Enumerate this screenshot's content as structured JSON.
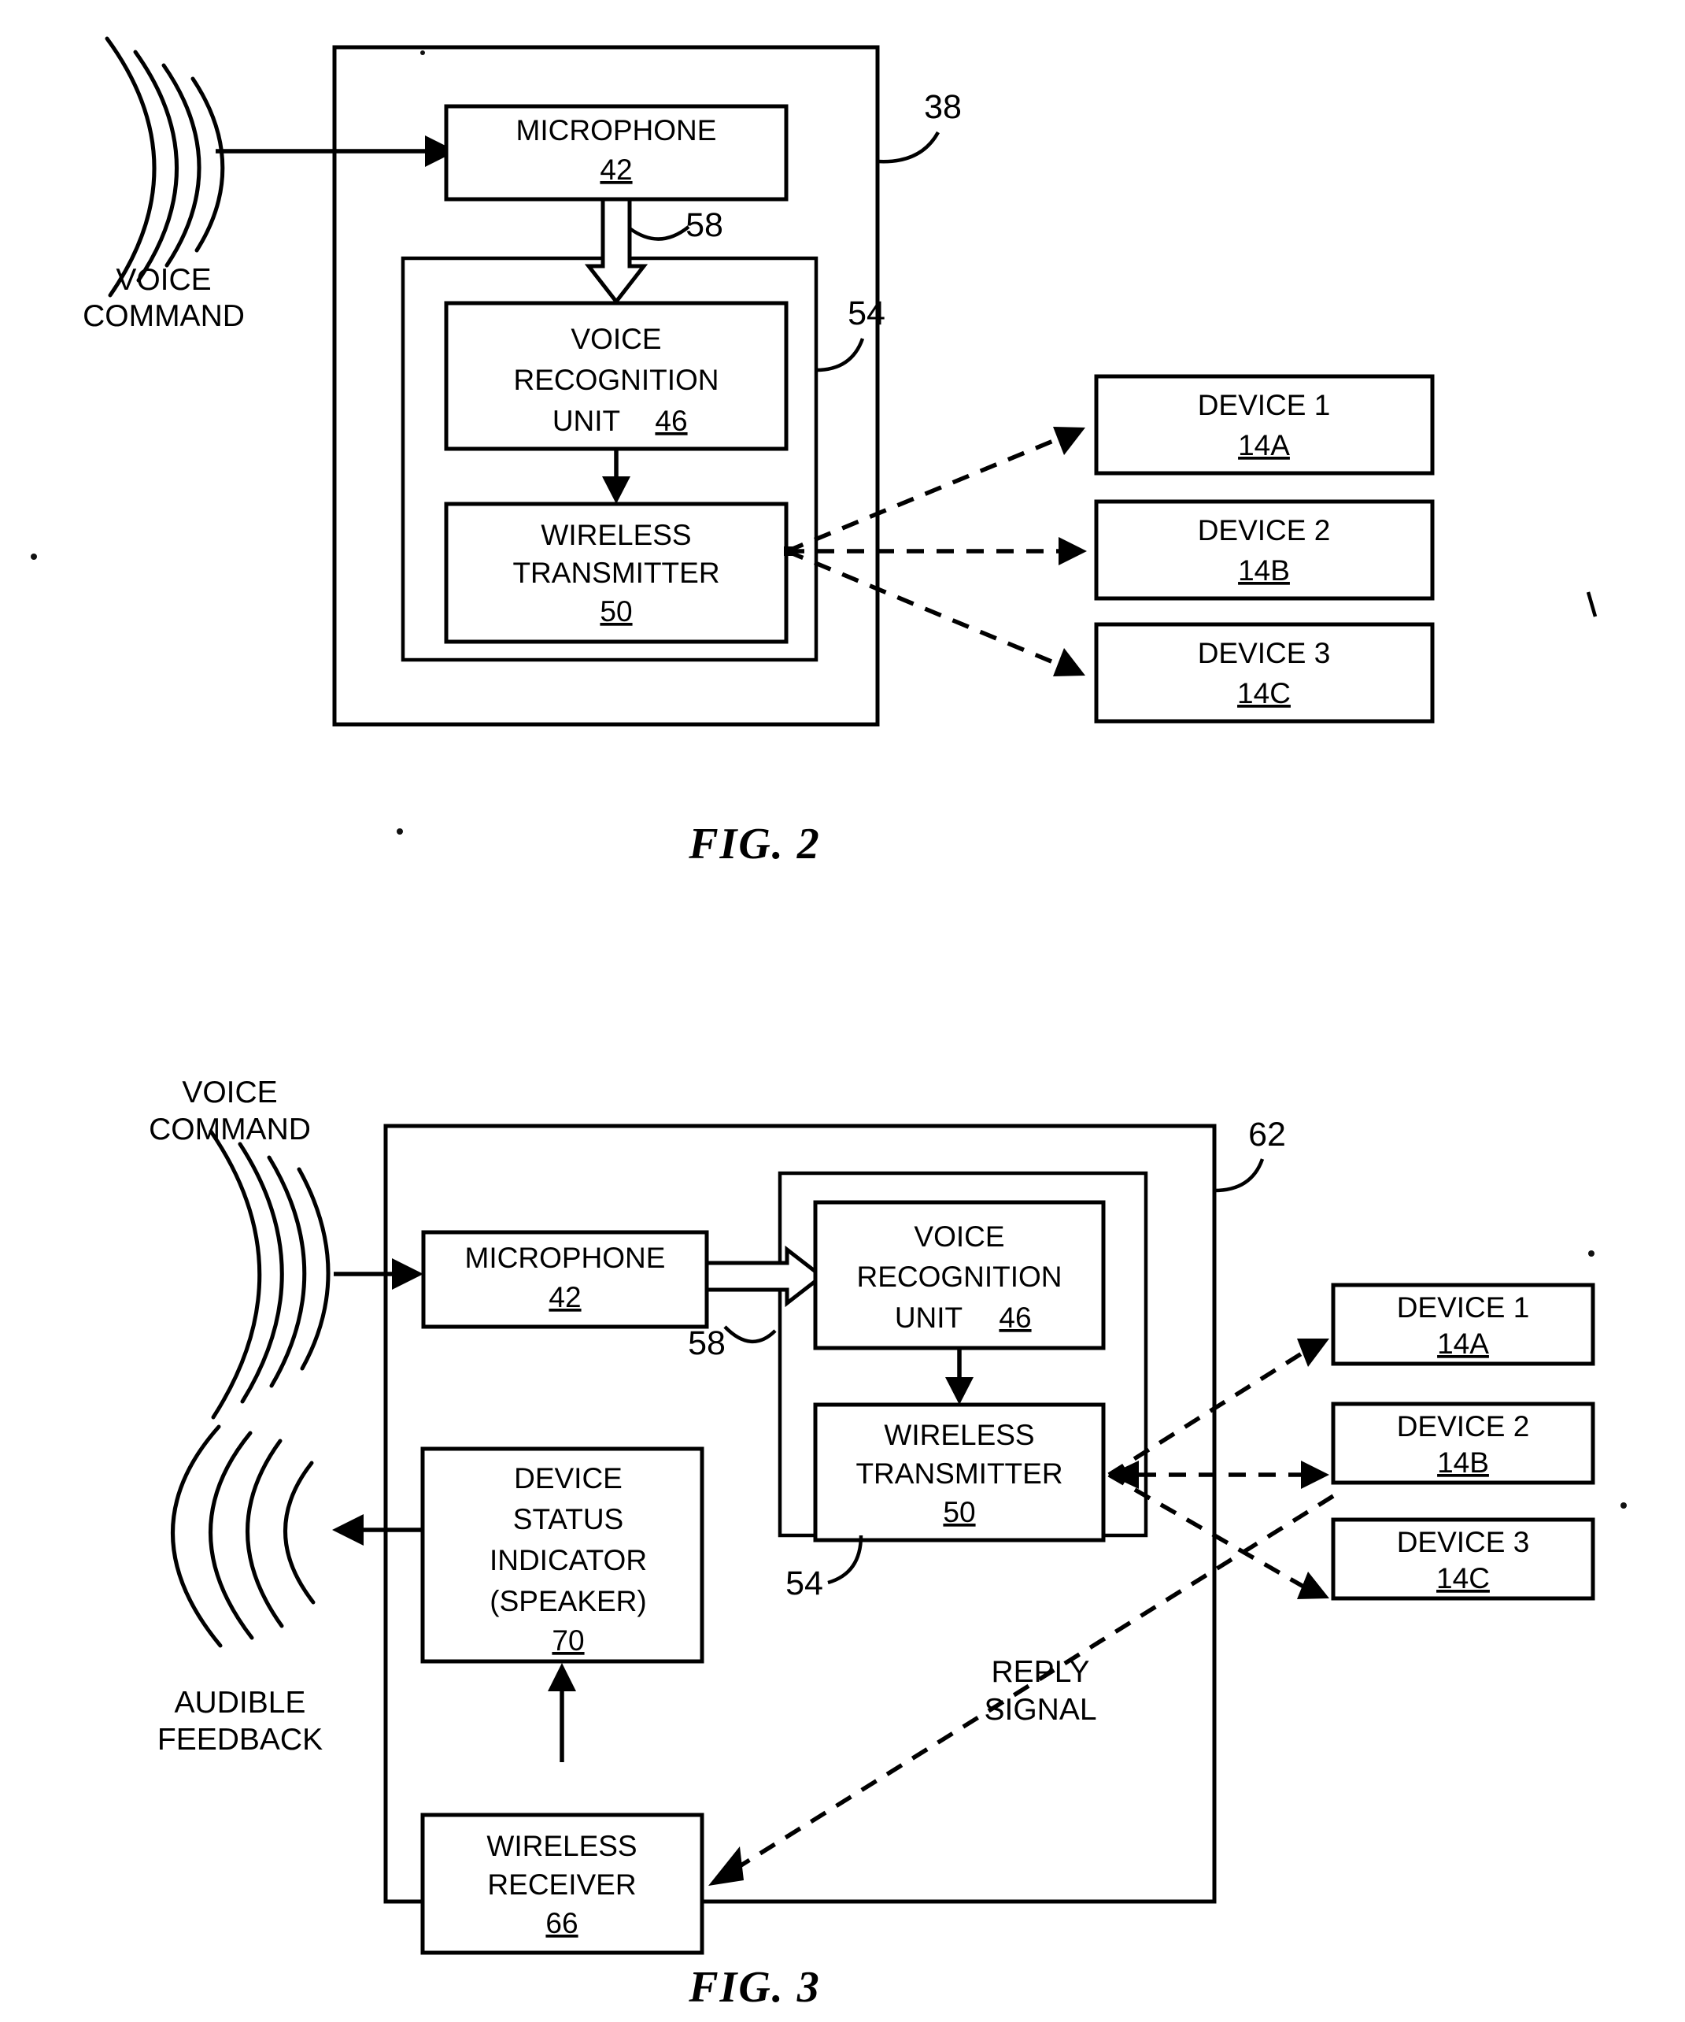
{
  "page": {
    "background": "#ffffff",
    "ink": "#000000"
  },
  "figures": [
    {
      "id": "fig2",
      "caption": "FIG. 2",
      "system_ref": "38",
      "external_labels": [
        {
          "name": "voice-command",
          "line1": "VOICE",
          "line2": "COMMAND"
        }
      ],
      "inner_assembly_ref": "54",
      "signal_ref": "58",
      "blocks": [
        {
          "name": "microphone",
          "title": "MICROPHONE",
          "ref": "42"
        },
        {
          "name": "voice-recognition-unit",
          "title_line1": "VOICE",
          "title_line2": "RECOGNITION",
          "title_line3": "UNIT",
          "ref": "46"
        },
        {
          "name": "wireless-transmitter",
          "title_line1": "WIRELESS",
          "title_line2": "TRANSMITTER",
          "ref": "50"
        }
      ],
      "devices": [
        {
          "name": "device-1",
          "title": "DEVICE 1",
          "ref": "14A"
        },
        {
          "name": "device-2",
          "title": "DEVICE 2",
          "ref": "14B"
        },
        {
          "name": "device-3",
          "title": "DEVICE 3",
          "ref": "14C"
        }
      ]
    },
    {
      "id": "fig3",
      "caption": "FIG. 3",
      "system_ref": "62",
      "external_labels": [
        {
          "name": "voice-command",
          "line1": "VOICE",
          "line2": "COMMAND"
        },
        {
          "name": "audible-feedback",
          "line1": "AUDIBLE",
          "line2": "FEEDBACK"
        },
        {
          "name": "reply-signal",
          "line1": "REPLY",
          "line2": "SIGNAL"
        }
      ],
      "inner_assembly_ref": "54",
      "signal_ref": "58",
      "blocks": [
        {
          "name": "microphone",
          "title": "MICROPHONE",
          "ref": "42"
        },
        {
          "name": "voice-recognition-unit",
          "title_line1": "VOICE",
          "title_line2": "RECOGNITION",
          "title_line3": "UNIT",
          "ref": "46"
        },
        {
          "name": "wireless-transmitter",
          "title_line1": "WIRELESS",
          "title_line2": "TRANSMITTER",
          "ref": "50"
        },
        {
          "name": "device-status-indicator",
          "title_line1": "DEVICE",
          "title_line2": "STATUS",
          "title_line3": "INDICATOR",
          "title_line4": "(SPEAKER)",
          "ref": "70"
        },
        {
          "name": "wireless-receiver",
          "title_line1": "WIRELESS",
          "title_line2": "RECEIVER",
          "ref": "66"
        }
      ],
      "devices": [
        {
          "name": "device-1",
          "title": "DEVICE 1",
          "ref": "14A"
        },
        {
          "name": "device-2",
          "title": "DEVICE 2",
          "ref": "14B"
        },
        {
          "name": "device-3",
          "title": "DEVICE 3",
          "ref": "14C"
        }
      ]
    }
  ]
}
